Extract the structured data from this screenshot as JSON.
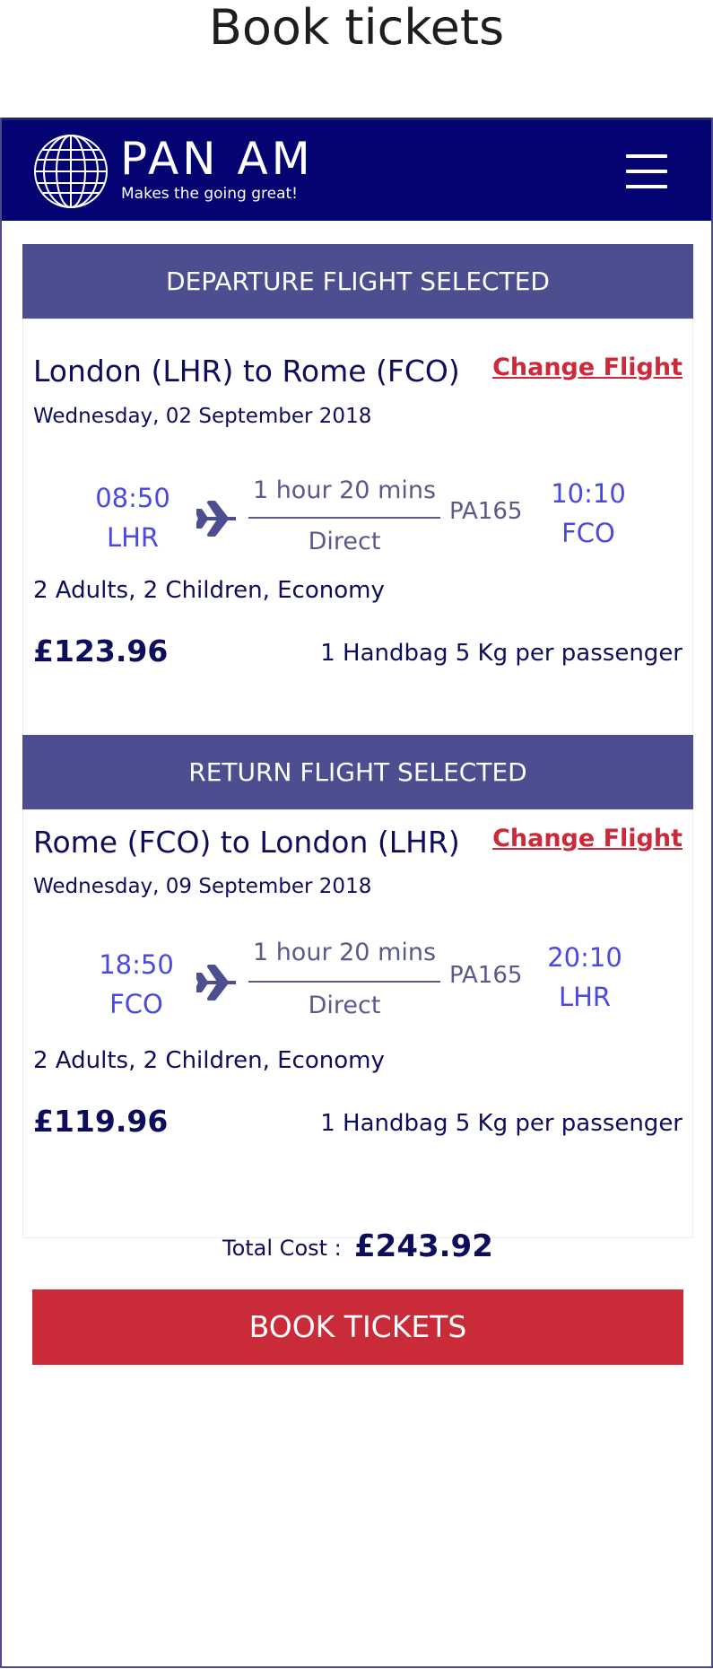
{
  "page": {
    "title": "Book tickets"
  },
  "brand": {
    "name": "PAN AM",
    "tagline": "Makes the going great!"
  },
  "colors": {
    "navy": "#030372",
    "section": "#4d4e90",
    "accent": "#4a4ae0",
    "cta": "#c92b39"
  },
  "icons": {
    "menu": "hamburger-menu-icon",
    "plane": "airplane-icon",
    "logo": "globe-logo-icon"
  },
  "departure": {
    "header": "DEPARTURE FLIGHT SELECTED",
    "route": "London (LHR) to Rome (FCO)",
    "change_label": "Change Flight",
    "date": "Wednesday, 02 September 2018",
    "dep_time": "08:50",
    "dep_airport": "LHR",
    "duration": "1 hour 20 mins",
    "stops": "Direct",
    "flight_no": "PA165",
    "arr_time": "10:10",
    "arr_airport": "FCO",
    "passengers": "2 Adults, 2 Children, Economy",
    "price": "£123.96",
    "baggage": "1 Handbag 5 Kg per passenger"
  },
  "return": {
    "header": "RETURN FLIGHT SELECTED",
    "route": "Rome (FCO) to London (LHR)",
    "change_label": "Change Flight",
    "date": "Wednesday, 09 September 2018",
    "dep_time": "18:50",
    "dep_airport": "FCO",
    "duration": "1 hour 20 mins",
    "stops": "Direct",
    "flight_no": "PA165",
    "arr_time": "20:10",
    "arr_airport": "LHR",
    "passengers": "2 Adults, 2 Children, Economy",
    "price": "£119.96",
    "baggage": "1 Handbag 5 Kg per passenger"
  },
  "summary": {
    "total_label": "Total Cost :",
    "total_value": "£243.92",
    "book_label": "BOOK TICKETS"
  }
}
